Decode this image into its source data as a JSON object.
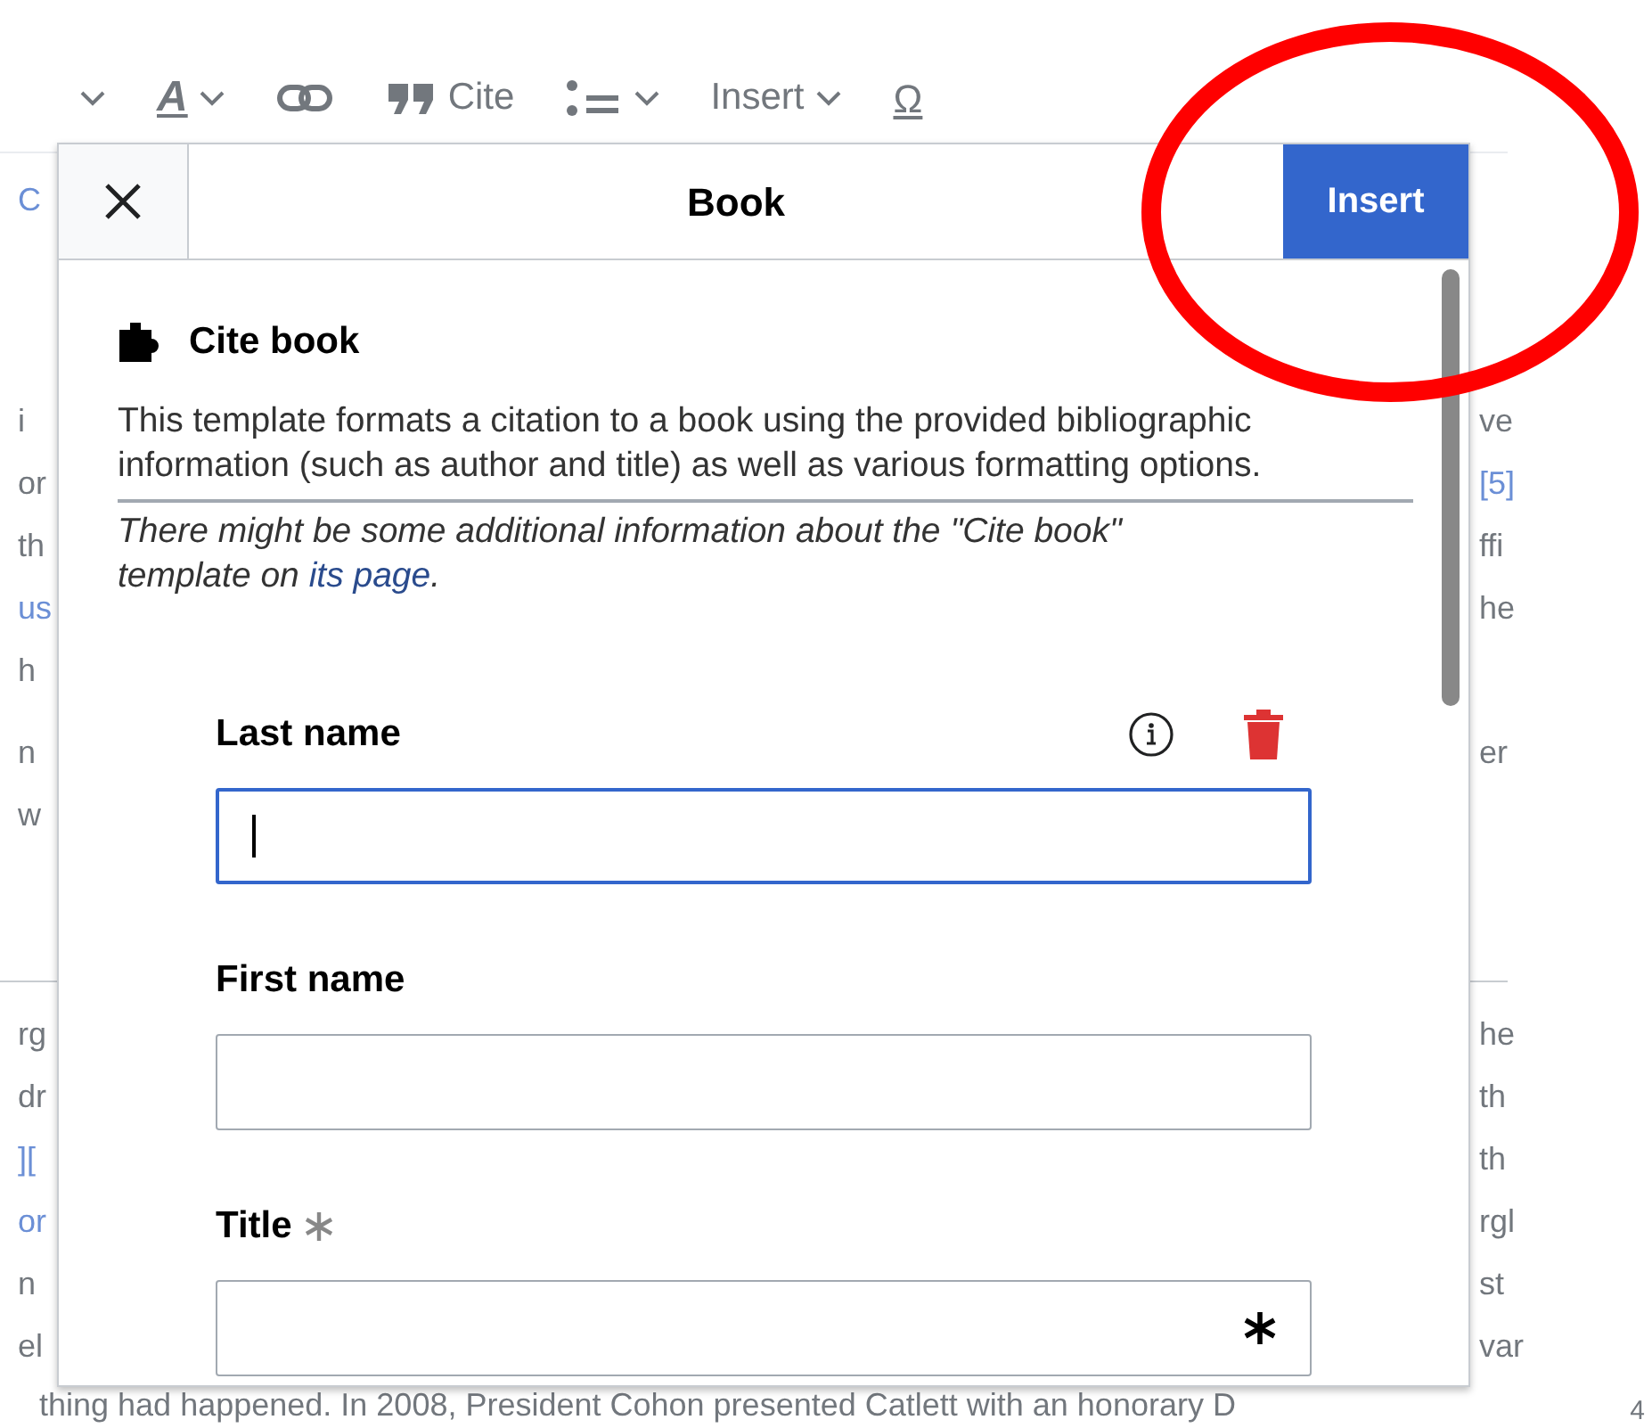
{
  "toolbar": [
    {
      "kind": "dropdown"
    },
    {
      "kind": "text-style",
      "glyph": "A"
    },
    {
      "kind": "link"
    },
    {
      "kind": "cite",
      "label": "Cite"
    },
    {
      "kind": "list"
    },
    {
      "kind": "insert",
      "label": "Insert"
    },
    {
      "kind": "special",
      "glyph": "Ω"
    }
  ],
  "article": {
    "top_fragment": {
      "text": "C",
      "link": true
    },
    "paragraphs": [
      [
        {
          "left": {
            "text": "i",
            "link": false
          },
          "right": {
            "text": "ve",
            "link": false
          }
        },
        {
          "left": {
            "text": "or",
            "link": false
          },
          "right": {
            "text": "[5]",
            "link": true
          }
        },
        {
          "left": {
            "text": "th",
            "link": false
          },
          "right": {
            "text": "ffi",
            "link": false
          }
        },
        {
          "left": {
            "text": "us",
            "link": true
          },
          "right": {
            "text": "he",
            "link": false
          }
        },
        {
          "left": {
            "text": "h",
            "link": false
          }
        },
        {
          "left": {
            "text": "n",
            "link": false
          },
          "right": {
            "text": "er",
            "link": false
          }
        },
        {
          "left": {
            "text": "w",
            "link": false
          }
        }
      ],
      [
        {
          "left": {
            "text": "rg",
            "link": false
          },
          "right": {
            "text": "he",
            "link": false
          }
        },
        {
          "left": {
            "text": "dr",
            "link": false
          },
          "right": {
            "text": "th",
            "link": false
          }
        },
        {
          "left": {
            "text": "][",
            "link": true
          },
          "right": {
            "text": "th",
            "link": false
          }
        },
        {
          "left": {
            "text": "or",
            "link": true
          },
          "right": {
            "text": "rgl",
            "link": false
          }
        },
        {
          "left": {
            "text": "n",
            "link": false
          },
          "right": {
            "text": "st",
            "link": false
          }
        },
        {
          "left": {
            "text": "el",
            "link": false
          },
          "right": {
            "text": "var",
            "link": false
          }
        }
      ]
    ],
    "bottom_line": "thing had happened. In 2008, President Cohon presented Catlett with an honorary D",
    "page_number": "4"
  },
  "dialog": {
    "title": "Book",
    "action": "Insert",
    "template": {
      "name": "Cite book",
      "description": "This template formats a citation to a book using the provided bibliographic information (such as author and title) as well as various formatting options.",
      "note": "There might be some additional information about the \"Cite book\" template on ",
      "note_link": "its page",
      "note_end": "."
    },
    "fields": [
      {
        "label": "Last name",
        "focused": true,
        "required": false
      },
      {
        "label": "First name",
        "focused": false,
        "required": false
      },
      {
        "label": "Title",
        "focused": false,
        "required": true
      }
    ]
  },
  "annotation": {
    "kind": "ellipse"
  }
}
